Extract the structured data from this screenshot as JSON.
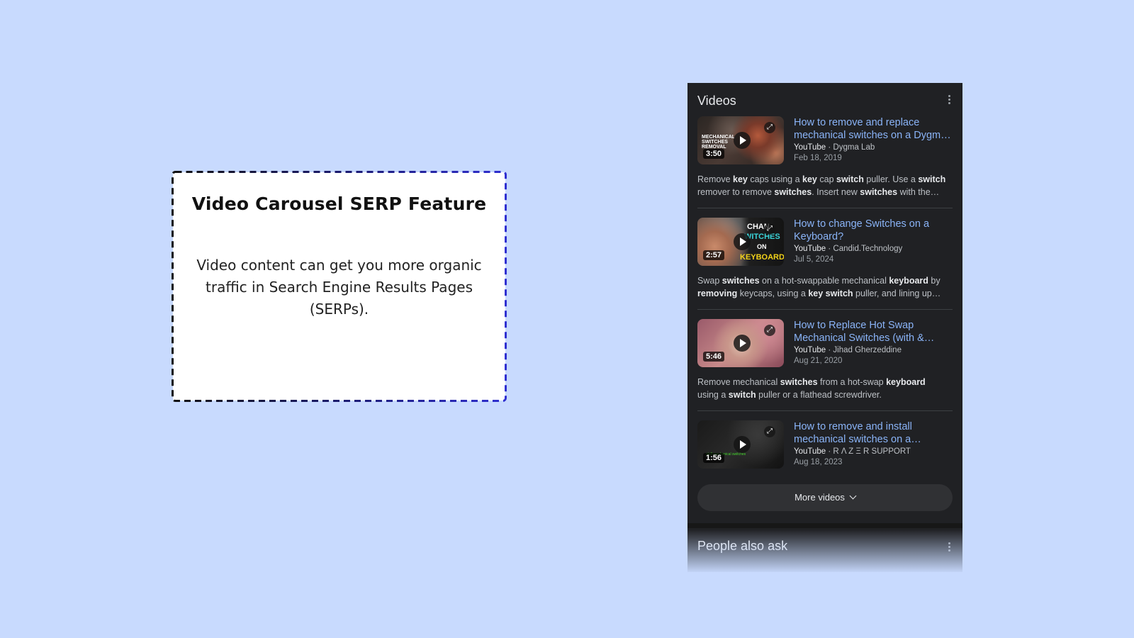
{
  "callout": {
    "title": "Video Carousel SERP Feature",
    "body": "Video content can get you more organic traffic in Search Engine Results Pages (SERPs)."
  },
  "serp": {
    "section_title": "Videos",
    "videos": [
      {
        "title_line1": "How to remove and replace",
        "title_line2": "mechanical switches on a Dygm…",
        "platform": "YouTube",
        "channel": " · Dygma Lab",
        "date": "Feb 18, 2019",
        "duration": "3:50",
        "thumb_text": "MECHANICAL SWITCHES REMOVAL",
        "snippet": [
          [
            [
              "Remove ",
              false
            ],
            [
              "key",
              true
            ],
            [
              " caps using a ",
              false
            ],
            [
              "key",
              true
            ],
            [
              " cap ",
              false
            ],
            [
              "switch",
              true
            ],
            [
              " puller. Use a ",
              false
            ],
            [
              "switch",
              true
            ]
          ],
          [
            [
              "remover to remove ",
              false
            ],
            [
              "switches",
              true
            ],
            [
              ". Insert new ",
              false
            ],
            [
              "switches",
              true
            ],
            [
              " with the…",
              false
            ]
          ]
        ]
      },
      {
        "title_line1": "How to change Switches on a",
        "title_line2": "Keyboard?",
        "platform": "YouTube",
        "channel": " · Candid.Technology",
        "date": "Jul 5, 2024",
        "duration": "2:57",
        "thumb_text_1": "CHAN",
        "thumb_text_2": "WITCHES",
        "thumb_text_3": "ON",
        "thumb_text_4": "KEYBOARD",
        "snippet": [
          [
            [
              "Swap ",
              false
            ],
            [
              "switches",
              true
            ],
            [
              " on a hot-swappable mechanical ",
              false
            ],
            [
              "keyboard",
              true
            ],
            [
              " by",
              false
            ]
          ],
          [
            [
              "removing",
              true
            ],
            [
              " keycaps, using a ",
              false
            ],
            [
              "key switch",
              true
            ],
            [
              " puller, and lining up…",
              false
            ]
          ]
        ]
      },
      {
        "title_line1": "How to Replace Hot Swap",
        "title_line2": "Mechanical Switches (with &…",
        "platform": "YouTube",
        "channel": " · Jihad Gherzeddine",
        "date": "Aug 21, 2020",
        "duration": "5:46",
        "snippet": [
          [
            [
              "Remove mechanical ",
              false
            ],
            [
              "switches",
              true
            ],
            [
              " from a hot-swap ",
              false
            ],
            [
              "keyboard",
              true
            ]
          ],
          [
            [
              "using a ",
              false
            ],
            [
              "switch",
              true
            ],
            [
              " puller or a flathead screwdriver.",
              false
            ]
          ]
        ]
      },
      {
        "title_line1": "How to remove and install",
        "title_line2": "mechanical switches on a…",
        "platform": "YouTube",
        "channel": " · R Λ Z Ξ R SUPPORT",
        "date": "Aug 18, 2023",
        "duration": "1:56",
        "thumb_text": "stall mechanical switches",
        "snippet": []
      }
    ],
    "more_label": "More videos",
    "people_also_ask": "People also ask"
  },
  "colors": {
    "page_bg": "#c8dafe",
    "panel_bg": "#202124",
    "link": "#8ab4f8",
    "dash_dark": "#111111",
    "dash_blue": "#2f2fd1"
  },
  "icons": [
    "play-icon",
    "expand-icon",
    "kebab-menu-icon",
    "chevron-down-icon"
  ]
}
